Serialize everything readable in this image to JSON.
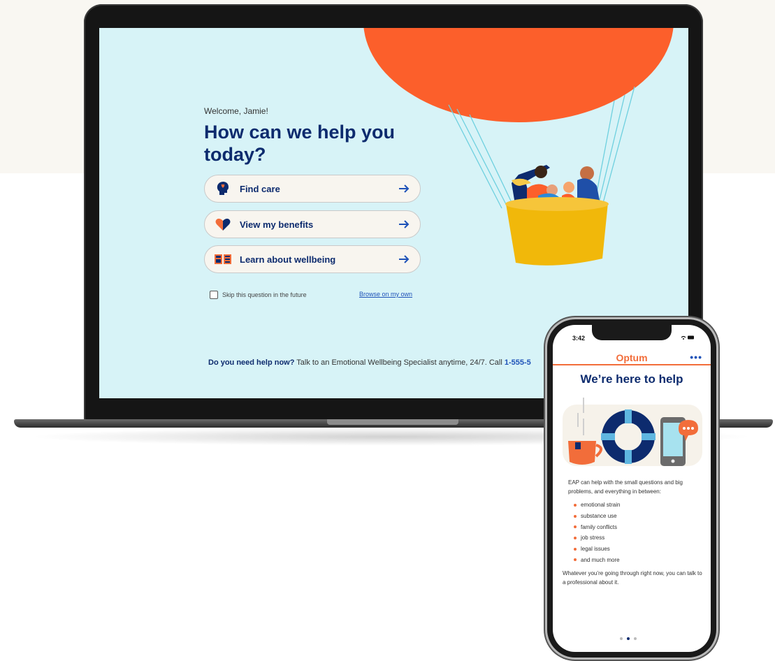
{
  "laptop": {
    "welcome": "Welcome, Jamie!",
    "headline": "How can we help you today?",
    "options": [
      {
        "label": "Find care",
        "icon": "head-heart-icon"
      },
      {
        "label": "View my benefits",
        "icon": "heart-icon"
      },
      {
        "label": "Learn about wellbeing",
        "icon": "book-icon"
      }
    ],
    "skip_label": "Skip this question in the future",
    "browse_link": "Browse on my own",
    "help_bold": "Do you need help now?",
    "help_text": " Talk to an Emotional Wellbeing Specialist anytime, 24/7. Call ",
    "help_phone": "1-555-5"
  },
  "phone": {
    "time": "3:42",
    "brand": "Optum",
    "more": "•••",
    "title": "We’re here to help",
    "intro": "EAP can help with the small questions and big problems, and everything in between:",
    "bullets": [
      "emotional strain",
      "substance use",
      "family conflicts",
      "job stress",
      "legal issues",
      "and much more"
    ],
    "closing": "Whatever you’re going through right now, you can talk to a professional about it."
  },
  "colors": {
    "screen_bg": "#d7f3f7",
    "navy": "#0d2b6e",
    "orange": "#f26d3a",
    "link_blue": "#1e52b8",
    "balloon": "#fc5f2b",
    "basket": "#f1b80a"
  }
}
